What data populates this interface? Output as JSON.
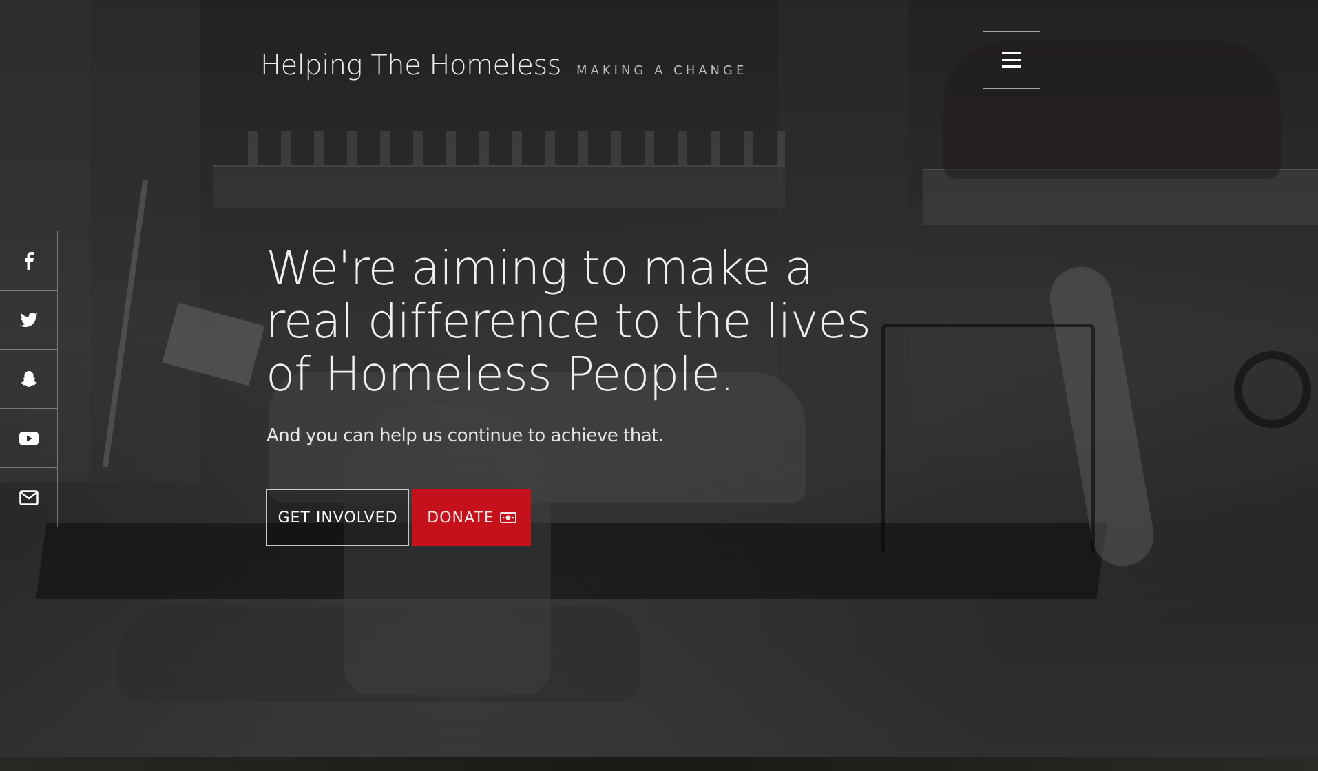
{
  "header": {
    "site_title": "Helping The Homeless",
    "tagline": "MAKING A CHANGE",
    "menu_icon": "hamburger-menu-icon"
  },
  "social": [
    {
      "icon": "facebook-icon"
    },
    {
      "icon": "twitter-icon"
    },
    {
      "icon": "snapchat-icon"
    },
    {
      "icon": "youtube-icon"
    },
    {
      "icon": "email-icon"
    }
  ],
  "hero": {
    "headline": "We're aiming to make a real difference to the lives of Homeless People.",
    "subline": "And you can help us continue to achieve that.",
    "get_involved_label": "GET INVOLVED",
    "donate_label": "DONATE",
    "donate_icon": "money-icon"
  },
  "colors": {
    "donate_red": "#c4111b",
    "text": "#f0f0f0"
  }
}
